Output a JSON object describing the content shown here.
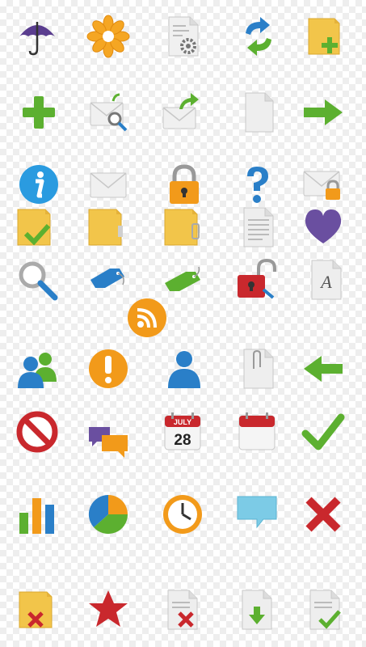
{
  "colors": {
    "green": "#5cb030",
    "blue": "#2a7fc8",
    "orange": "#f29a1a",
    "red": "#c9282d",
    "yellow": "#f2c54a",
    "purple": "#6a4fa0",
    "gray": "#cfcfcf"
  },
  "icons": {
    "calendar_month": "JULY",
    "calendar_day": "28",
    "font_letter": "A"
  }
}
